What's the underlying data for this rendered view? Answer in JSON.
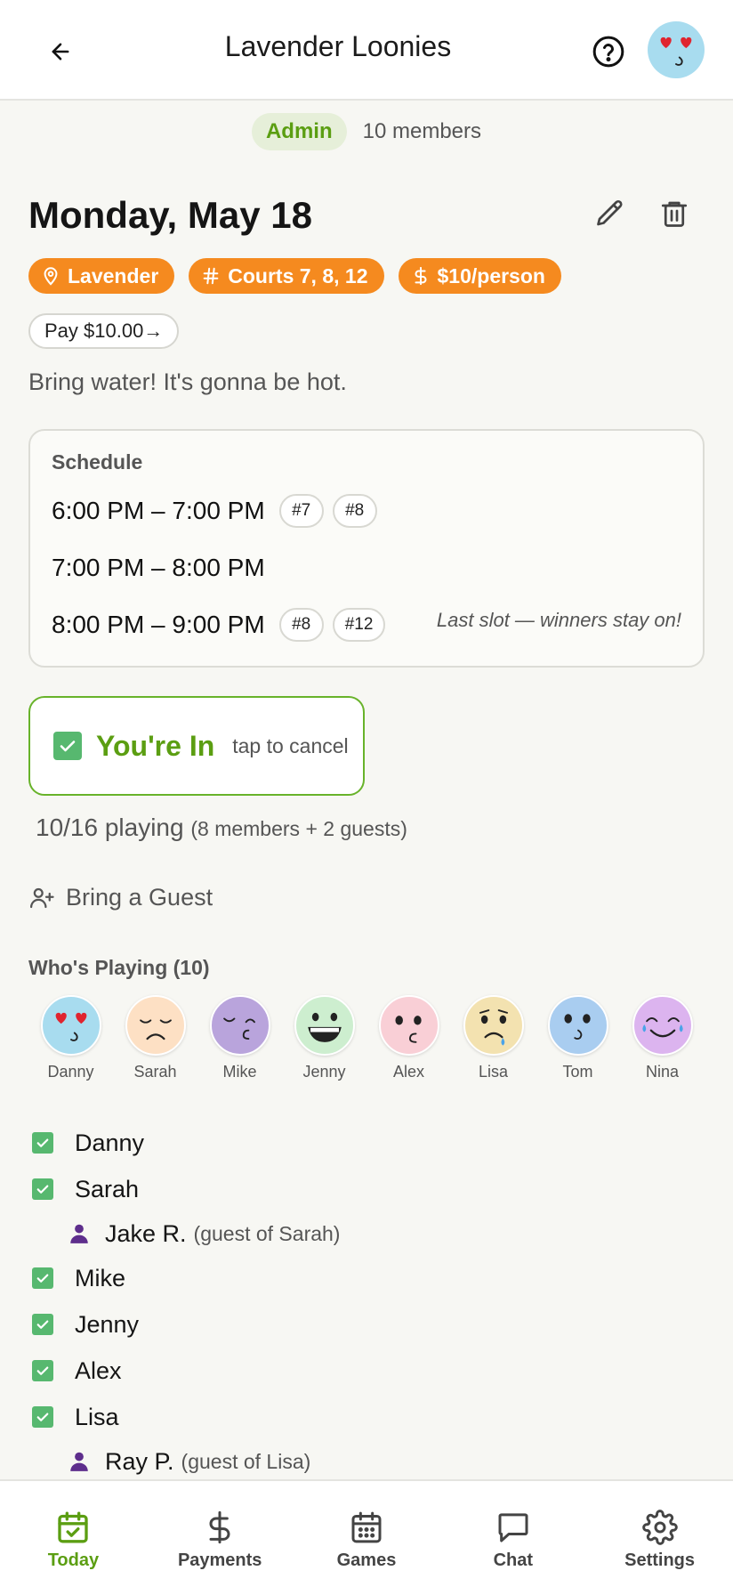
{
  "header": {
    "title": "Lavender Loonies",
    "back_icon": "arrow-left-icon",
    "help_icon": "help-circle-icon"
  },
  "group": {
    "role_badge": "Admin",
    "member_count": "10 members"
  },
  "session": {
    "date": "Monday, May 18",
    "chips": {
      "location": "Lavender",
      "courts": "Courts 7, 8, 12",
      "price": "$10/person"
    },
    "pay_label": "Pay $10.00→",
    "note": "Bring water! It's gonna be hot."
  },
  "schedule": {
    "label": "Schedule",
    "slots": [
      {
        "time": "6:00 PM – 7:00 PM",
        "courts": [
          "#7",
          "#8"
        ]
      },
      {
        "time": "7:00 PM – 8:00 PM",
        "courts": []
      },
      {
        "time": "8:00 PM – 9:00 PM",
        "courts": [
          "#8",
          "#12"
        ]
      }
    ],
    "last_slot_note": "Last slot — winners stay on!"
  },
  "rsvp": {
    "status": "You're In",
    "hint": "tap to cancel"
  },
  "playing": {
    "count": "10/16 playing",
    "breakdown": "(8 members + 2 guests)"
  },
  "bring_guest": "Bring a Guest",
  "whos_playing": {
    "heading": "Who's Playing (10)",
    "avatars": [
      {
        "name": "Danny",
        "face": "heart-eyes",
        "color": "#a8dcef"
      },
      {
        "name": "Sarah",
        "face": "sad",
        "color": "#fde0c4"
      },
      {
        "name": "Mike",
        "face": "sleepy",
        "color": "#b9a4dc"
      },
      {
        "name": "Jenny",
        "face": "grin",
        "color": "#cdeecf"
      },
      {
        "name": "Alex",
        "face": "worried",
        "color": "#f9cfd6"
      },
      {
        "name": "Lisa",
        "face": "crying",
        "color": "#f3e2b0"
      },
      {
        "name": "Tom",
        "face": "neutral",
        "color": "#a9cdf0"
      },
      {
        "name": "Nina",
        "face": "tears-of-joy",
        "color": "#dcb4ef"
      }
    ]
  },
  "roster": [
    {
      "name": "Danny",
      "type": "member"
    },
    {
      "name": "Sarah",
      "type": "member"
    },
    {
      "name": "Jake R.",
      "type": "guest",
      "note": "(guest of Sarah)"
    },
    {
      "name": "Mike",
      "type": "member"
    },
    {
      "name": "Jenny",
      "type": "member"
    },
    {
      "name": "Alex",
      "type": "member"
    },
    {
      "name": "Lisa",
      "type": "member"
    },
    {
      "name": "Ray P.",
      "type": "guest",
      "note": "(guest of Lisa)"
    }
  ],
  "tabs": [
    {
      "label": "Today",
      "icon": "calendar-check-icon",
      "active": true
    },
    {
      "label": "Payments",
      "icon": "dollar-icon",
      "active": false
    },
    {
      "label": "Games",
      "icon": "calendar-grid-icon",
      "active": false
    },
    {
      "label": "Chat",
      "icon": "chat-bubble-icon",
      "active": false
    },
    {
      "label": "Settings",
      "icon": "gear-icon",
      "active": false
    }
  ],
  "colors": {
    "accent_green": "#5b9e12",
    "chip_orange": "#f58a1f",
    "check_green": "#57b86f",
    "guest_purple": "#5e2e8c"
  }
}
